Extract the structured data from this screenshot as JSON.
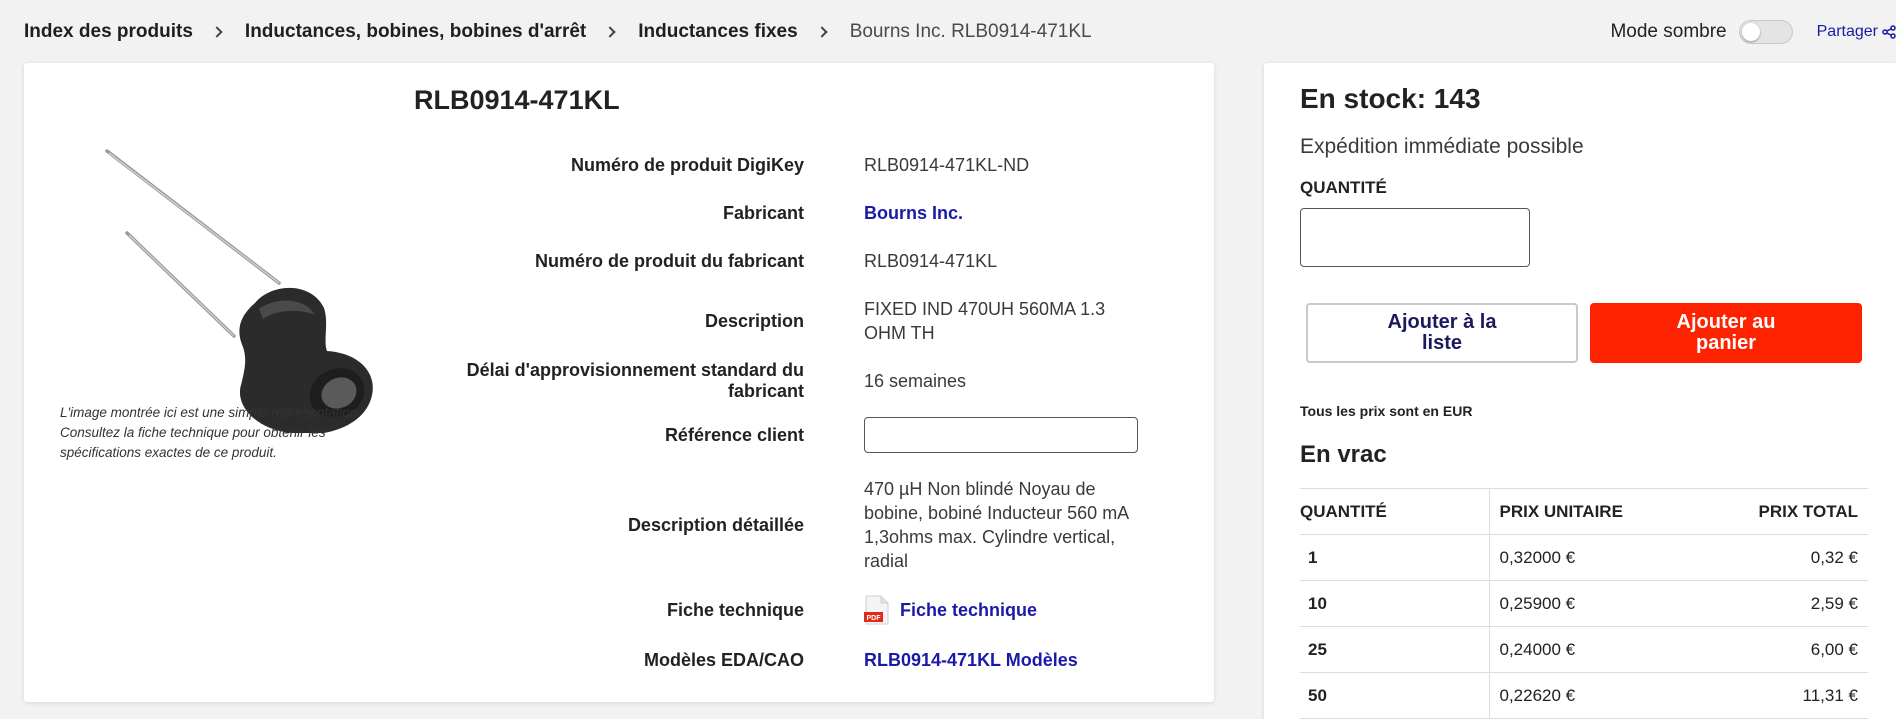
{
  "breadcrumb": {
    "items": [
      "Index des produits",
      "Inductances, bobines, bobines d'arrêt",
      "Inductances fixes"
    ],
    "current": "Bourns Inc. RLB0914-471KL"
  },
  "header": {
    "dark_mode_label": "Mode sombre",
    "share_label": "Partager"
  },
  "product": {
    "title": "RLB0914-471KL",
    "image_note": "L'image montrée ici est une simple représentation. Consultez la fiche technique pour obtenir les spécifications exactes de ce produit.",
    "specs": {
      "digikey_pn": {
        "label": "Numéro de produit DigiKey",
        "value": "RLB0914-471KL-ND"
      },
      "manufacturer": {
        "label": "Fabricant",
        "value": "Bourns Inc."
      },
      "mfr_pn": {
        "label": "Numéro de produit du fabricant",
        "value": "RLB0914-471KL"
      },
      "description": {
        "label": "Description",
        "value": "FIXED IND 470UH 560MA 1.3 OHM TH"
      },
      "lead_time": {
        "label": "Délai d'approvisionnement standard du fabricant",
        "value": "16 semaines"
      },
      "customer_ref": {
        "label": "Référence client",
        "value": ""
      },
      "detailed_description": {
        "label": "Description détaillée",
        "value": "470 µH Non blindé Noyau de bobine, bobiné Inducteur 560 mA 1,3ohms max. Cylindre vertical, radial"
      },
      "datasheet": {
        "label": "Fiche technique",
        "value": "Fiche technique"
      },
      "eda_models": {
        "label": "Modèles EDA/CAO",
        "value": "RLB0914-471KL Modèles"
      }
    }
  },
  "pricing": {
    "stock": "En stock: 143",
    "shipping": "Expédition immédiate possible",
    "quantity_label": "QUANTITÉ",
    "quantity_value": "",
    "add_to_list": "Ajouter à la liste",
    "add_to_cart": "Ajouter au panier",
    "currency_note": "Tous les prix sont en EUR",
    "bulk_title": "En vrac",
    "columns": [
      "QUANTITÉ",
      "PRIX UNITAIRE",
      "PRIX TOTAL"
    ],
    "rows": [
      {
        "qty": "1",
        "unit": "0,32000 €",
        "total": "0,32 €"
      },
      {
        "qty": "10",
        "unit": "0,25900 €",
        "total": "2,59 €"
      },
      {
        "qty": "25",
        "unit": "0,24000 €",
        "total": "6,00 €"
      },
      {
        "qty": "50",
        "unit": "0,22620 €",
        "total": "11,31 €"
      }
    ]
  },
  "colors": {
    "link": "#1a1aa8",
    "cart_button": "#ff2200",
    "page_background": "#f2f2f3"
  },
  "icons": {
    "breadcrumb_separator": "chevron-right-icon",
    "share": "share-icon",
    "datasheet": "pdf-icon"
  }
}
